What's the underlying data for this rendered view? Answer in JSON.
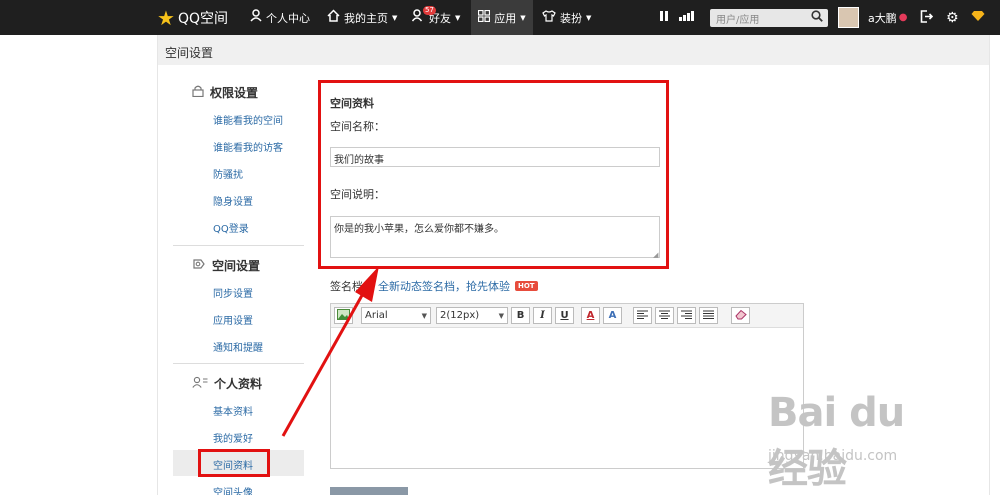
{
  "topbar": {
    "logo": "QQ空间",
    "personal_center": "个人中心",
    "my_homepage": "我的主页",
    "friends": "好友",
    "friends_badge": "57",
    "apps": "应用",
    "decorate": "装扮",
    "search_placeholder": "用户/应用",
    "username": "a大鹏"
  },
  "page": {
    "title": "空间设置"
  },
  "sidebar": {
    "sections": [
      {
        "title": "权限设置",
        "icon": "lock-icon",
        "items": [
          "谁能看我的空间",
          "谁能看我的访客",
          "防骚扰",
          "隐身设置",
          "QQ登录"
        ]
      },
      {
        "title": "空间设置",
        "icon": "settings-icon",
        "items": [
          "同步设置",
          "应用设置",
          "通知和提醒"
        ]
      },
      {
        "title": "个人资料",
        "icon": "user-list-icon",
        "items": [
          "基本资料",
          "我的爱好",
          "空间资料",
          "空间头像"
        ]
      }
    ],
    "active_item": "空间资料"
  },
  "form": {
    "section_title": "空间资料",
    "name_label": "空间名称：",
    "name_value": "我们的故事",
    "desc_label": "空间说明：",
    "desc_value": "你是的我小苹果，怎么爱你都不嫌多。",
    "signature_label": "签名档：",
    "signature_link": "全新动态签名档，抢先体验",
    "hot_badge": "HOT"
  },
  "editor": {
    "font_family": "Arial",
    "font_size": "2(12px)",
    "bold": "B",
    "italic": "I",
    "underline": "U",
    "font_color": "A",
    "highlight": "A"
  },
  "watermark": {
    "logo": "Bai du 经验",
    "url": "jingyan.baidu.com"
  },
  "colors": {
    "topbar_bg": "#1f1f1f",
    "link": "#2b6aa5",
    "annotation_red": "#e21111",
    "hot_badge": "#e74c3c"
  }
}
